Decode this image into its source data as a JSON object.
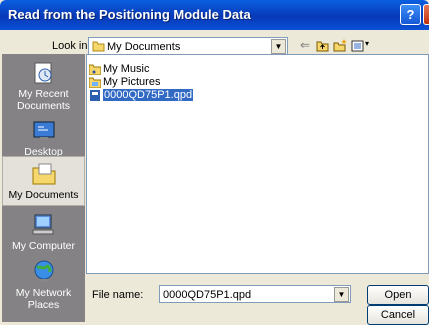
{
  "window": {
    "title": "Read from the Positioning Module Data",
    "help_label": "?",
    "close_label": "X"
  },
  "lookin": {
    "label": "Look in:",
    "value": "My Documents"
  },
  "places": [
    {
      "label": "My Recent Documents"
    },
    {
      "label": "Desktop"
    },
    {
      "label": "My Documents"
    },
    {
      "label": "My Computer"
    },
    {
      "label": "My Network Places"
    }
  ],
  "files": [
    {
      "name": "My Music",
      "kind": "folder",
      "icon": "music-folder-icon"
    },
    {
      "name": "My Pictures",
      "kind": "folder",
      "icon": "pictures-folder-icon"
    },
    {
      "name": "0000QD75P1.qpd",
      "kind": "file",
      "icon": "file-icon",
      "selected": true
    }
  ],
  "filename": {
    "label": "File name:",
    "value": "0000QD75P1.qpd"
  },
  "buttons": {
    "open": "Open",
    "cancel": "Cancel"
  }
}
